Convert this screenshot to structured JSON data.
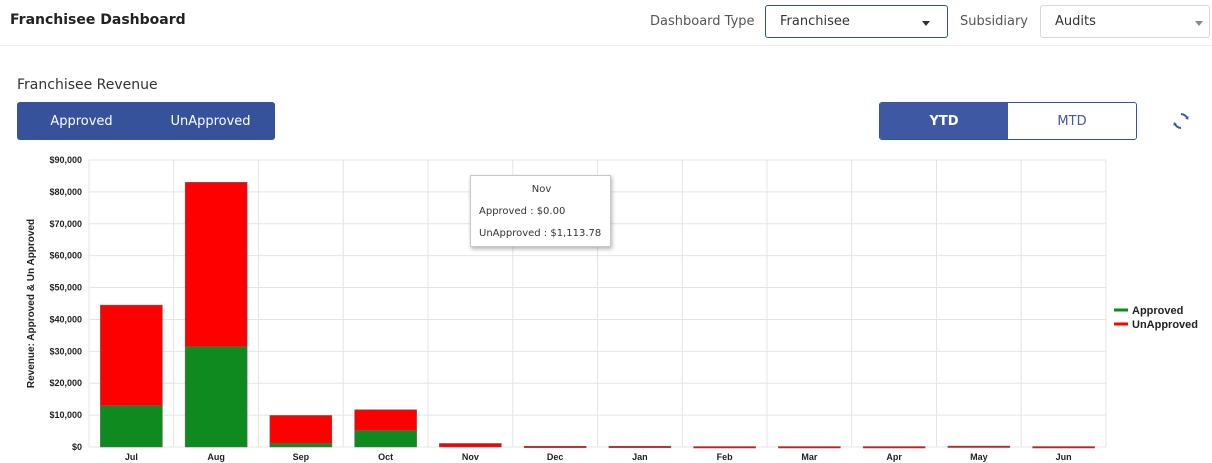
{
  "header": {
    "title": "Franchisee Dashboard",
    "dashboard_type_label": "Dashboard Type",
    "dashboard_type_value": "Franchisee",
    "subsidiary_label": "Subsidiary",
    "subsidiary_value": "Audits"
  },
  "section": {
    "title": "Franchisee Revenue",
    "status_toggle": [
      "Approved",
      "UnApproved"
    ],
    "period_toggle": {
      "active": "YTD",
      "inactive": "MTD"
    }
  },
  "icons": {
    "refresh": "refresh-icon",
    "caret": "chevron-down-icon"
  },
  "colors": {
    "approved": "#0f8a1f",
    "unapproved": "#ff0000",
    "accent": "#36529b"
  },
  "tooltip": {
    "title": "Nov",
    "approved_line": "Approved : $0.00",
    "unapproved_line": "UnApproved : $1,113.78"
  },
  "chart_data": {
    "type": "bar",
    "stacked": true,
    "categories": [
      "Jul",
      "Aug",
      "Sep",
      "Oct",
      "Nov",
      "Dec",
      "Jan",
      "Feb",
      "Mar",
      "Apr",
      "May",
      "Jun"
    ],
    "series": [
      {
        "name": "Approved",
        "color": "#0f8a1f",
        "values": [
          13000,
          31500,
          1200,
          5200,
          0,
          0,
          0,
          0,
          0,
          0,
          0,
          0
        ]
      },
      {
        "name": "UnApproved",
        "color": "#ff0000",
        "values": [
          31500,
          51500,
          8700,
          6500,
          1113.78,
          250,
          250,
          150,
          150,
          150,
          300,
          150
        ]
      }
    ],
    "ylabel": "Revenue: Approved & Un Approved",
    "ylim": [
      0,
      90000
    ],
    "yticks": [
      "$0",
      "$10,000",
      "$20,000",
      "$30,000",
      "$40,000",
      "$50,000",
      "$60,000",
      "$70,000",
      "$80,000",
      "$90,000"
    ],
    "legend": "right",
    "grid": true
  }
}
